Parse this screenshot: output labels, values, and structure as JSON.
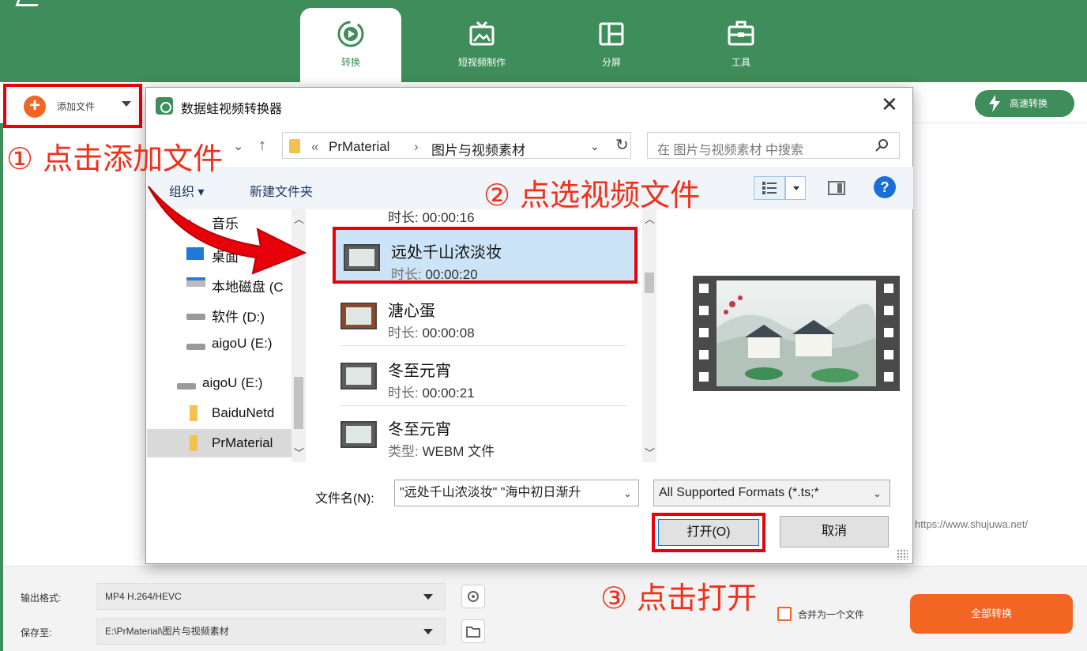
{
  "header": {
    "tabs": [
      {
        "label": "转换",
        "icon": "convert-icon",
        "active": true
      },
      {
        "label": "短视频制作",
        "icon": "tv-icon",
        "active": false
      },
      {
        "label": "分屏",
        "icon": "split-screen-icon",
        "active": false
      },
      {
        "label": "工具",
        "icon": "toolbox-icon",
        "active": false
      }
    ],
    "colors": {
      "brand_green": "#3f8d5a",
      "accent_orange": "#f26522",
      "annotation_red": "#e8000b"
    }
  },
  "toolbar": {
    "add_file_label": "添加文件",
    "speed_convert_label": "高速转换"
  },
  "annotations": {
    "step1": "① 点击添加文件",
    "step2": "② 点选视频文件",
    "step3": "③ 点击打开"
  },
  "watermark": "https://www.shujuwa.net/",
  "dialog": {
    "title": "数据蛙视频转换器",
    "address": {
      "root_chevron": "«",
      "crumb1": "PrMaterial",
      "separator": "›",
      "crumb2": "图片与视频素材"
    },
    "search_placeholder": "在 图片与视频素材 中搜索",
    "commands": {
      "organize": "组织 ▾",
      "new_folder": "新建文件夹"
    },
    "tree": [
      {
        "label": "音乐",
        "icon": "music-icon"
      },
      {
        "label": "桌面",
        "icon": "desktop-icon"
      },
      {
        "label": "本地磁盘 (C",
        "icon": "local-disk-icon"
      },
      {
        "label": "软件 (D:)",
        "icon": "drive-icon"
      },
      {
        "label": "aigoU (E:)",
        "icon": "drive-icon"
      },
      {
        "label": "aigoU (E:)",
        "icon": "drive-icon"
      },
      {
        "label": "BaiduNetd",
        "icon": "folder-icon"
      },
      {
        "label": "PrMaterial",
        "icon": "folder-icon",
        "selected": true
      }
    ],
    "files": [
      {
        "partial_meta": "时长: 00:00:16"
      },
      {
        "name": "远处千山浓淡妆",
        "meta_key": "时长:",
        "meta_val": "00:00:20",
        "selected": true
      },
      {
        "name": "溏心蛋",
        "meta_key": "时长:",
        "meta_val": "00:00:08"
      },
      {
        "name": "冬至元宵",
        "meta_key": "时长:",
        "meta_val": "00:00:21"
      },
      {
        "name": "冬至元宵",
        "meta_key": "类型:",
        "meta_val": "WEBM 文件"
      }
    ],
    "filename_label": "文件名(N):",
    "filename_value": "\"远处千山浓淡妆\" \"海中初日渐升",
    "filter_value": "All Supported Formats (*.ts;*",
    "open_label": "打开(O)",
    "cancel_label": "取消"
  },
  "bottom": {
    "output_format_label": "输出格式:",
    "output_format_value": "MP4 H.264/HEVC",
    "save_to_label": "保存至:",
    "save_to_value": "E:\\PrMaterial\\图片与视频素材",
    "merge_label": "合并为一个文件",
    "convert_all_label": "全部转换"
  }
}
